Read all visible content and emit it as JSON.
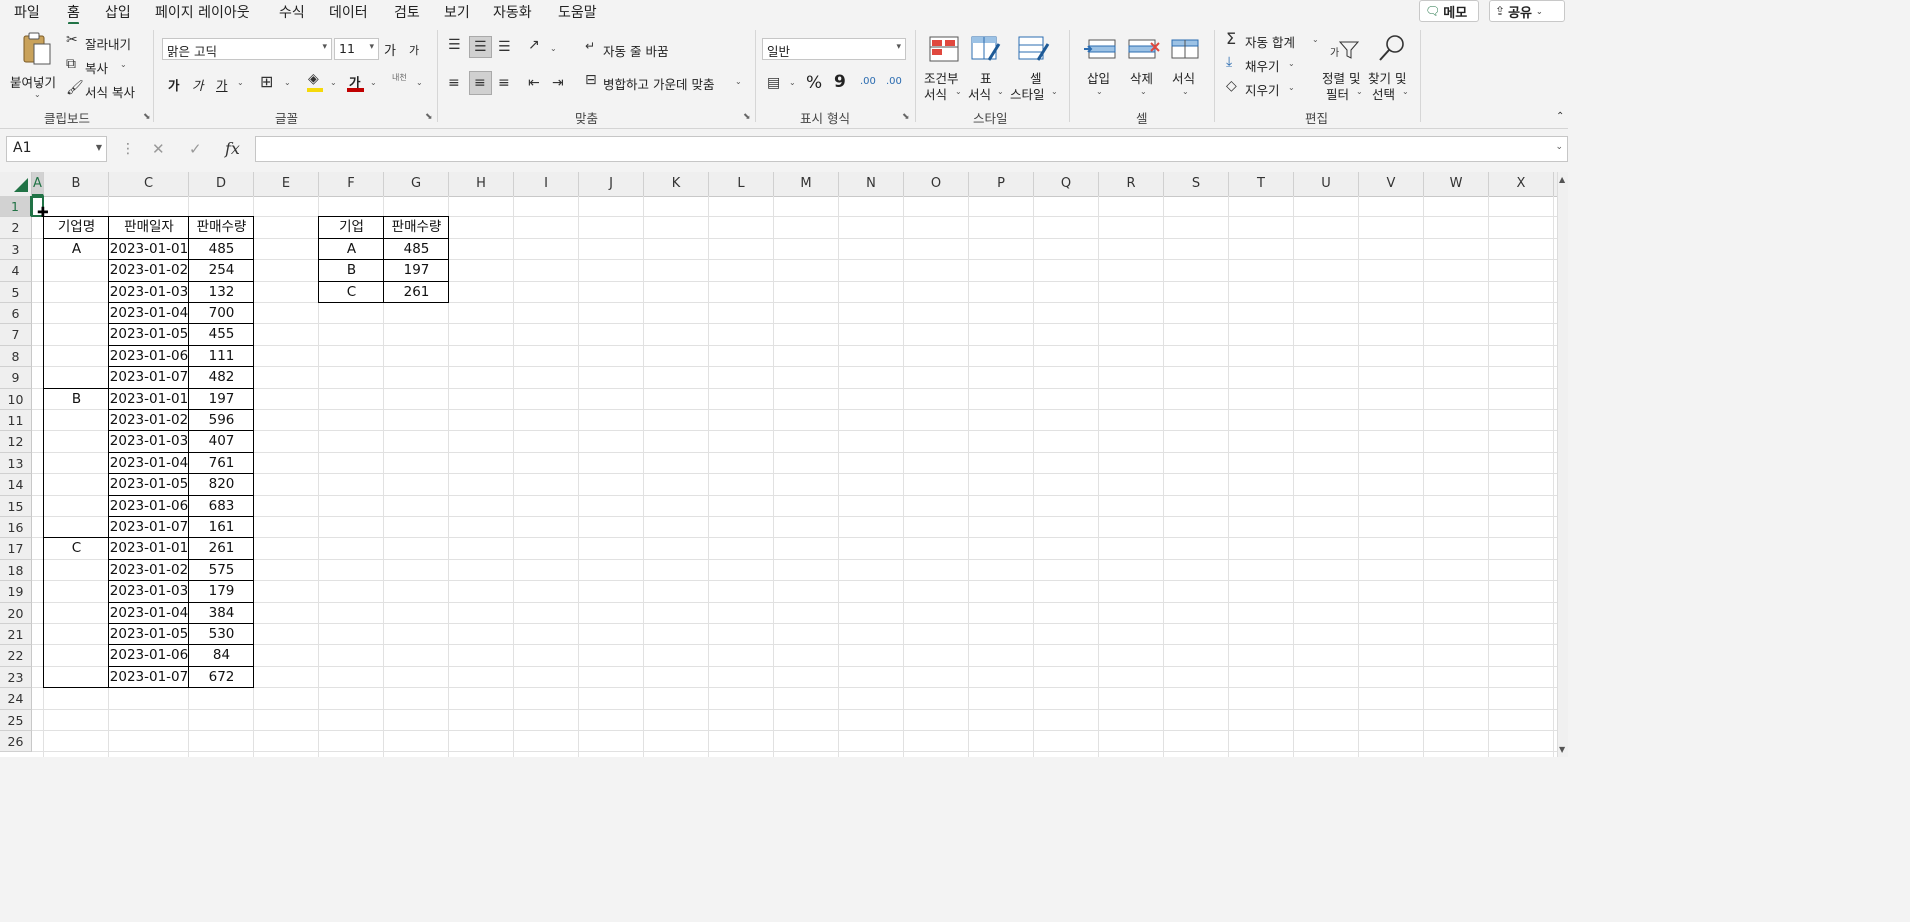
{
  "menu": {
    "tabs": [
      "파일",
      "홈",
      "삽입",
      "페이지 레이아웃",
      "수식",
      "데이터",
      "검토",
      "보기",
      "자동화",
      "도움말"
    ],
    "active": "홈",
    "memo_label": "메모",
    "share_label": "공유"
  },
  "ribbon": {
    "clipboard": {
      "paste": "붙여넣기",
      "cut": "잘라내기",
      "copy": "복사",
      "format_painter": "서식 복사",
      "label": "클립보드"
    },
    "font": {
      "name": "맑은 고딕",
      "size": "11",
      "grow": "가",
      "shrink": "가",
      "bold": "가",
      "italic": "가",
      "underline": "가",
      "color_glyph": "가",
      "phonetic": "내천",
      "label": "글꼴",
      "fill_color": "#f5d90a",
      "font_color": "#c00000"
    },
    "alignment": {
      "wrap": "자동 줄 바꿈",
      "merge": "병합하고 가운데 맞춤",
      "label": "맞춤"
    },
    "number": {
      "format": "일반",
      "percent": "%",
      "comma": "9",
      "inc": ".00",
      "dec": ".00",
      "label": "표시 형식"
    },
    "styles": {
      "conditional_1": "조건부",
      "conditional_2": "서식",
      "table_1": "표",
      "table_2": "서식",
      "cell_1": "셀",
      "cell_2": "스타일",
      "label": "스타일"
    },
    "cells": {
      "insert": "삽입",
      "delete": "삭제",
      "format": "서식",
      "label": "셀"
    },
    "editing": {
      "autosum": "자동 합계",
      "fill": "채우기",
      "clear": "지우기",
      "sort_1": "정렬 및",
      "sort_2": "필터",
      "find_1": "찾기 및",
      "find_2": "선택",
      "label": "편집"
    }
  },
  "formula_bar": {
    "name_box": "A1",
    "formula": ""
  },
  "columns": [
    "A",
    "B",
    "C",
    "D",
    "E",
    "F",
    "G",
    "H",
    "I",
    "J",
    "K",
    "L",
    "M",
    "N",
    "O",
    "P",
    "Q",
    "R",
    "S",
    "T",
    "U",
    "V",
    "W",
    "X"
  ],
  "rows": [
    "1",
    "2",
    "3",
    "4",
    "5",
    "6",
    "7",
    "8",
    "9",
    "10",
    "11",
    "12",
    "13",
    "14",
    "15",
    "16",
    "17",
    "18",
    "19",
    "20",
    "21",
    "22",
    "23",
    "24",
    "25",
    "26"
  ],
  "table1": {
    "headers": [
      "기업명",
      "판매일자",
      "판매수량"
    ],
    "rows": [
      [
        "A",
        "2023-01-01",
        "485"
      ],
      [
        "",
        "2023-01-02",
        "254"
      ],
      [
        "",
        "2023-01-03",
        "132"
      ],
      [
        "",
        "2023-01-04",
        "700"
      ],
      [
        "",
        "2023-01-05",
        "455"
      ],
      [
        "",
        "2023-01-06",
        "111"
      ],
      [
        "",
        "2023-01-07",
        "482"
      ],
      [
        "B",
        "2023-01-01",
        "197"
      ],
      [
        "",
        "2023-01-02",
        "596"
      ],
      [
        "",
        "2023-01-03",
        "407"
      ],
      [
        "",
        "2023-01-04",
        "761"
      ],
      [
        "",
        "2023-01-05",
        "820"
      ],
      [
        "",
        "2023-01-06",
        "683"
      ],
      [
        "",
        "2023-01-07",
        "161"
      ],
      [
        "C",
        "2023-01-01",
        "261"
      ],
      [
        "",
        "2023-01-02",
        "575"
      ],
      [
        "",
        "2023-01-03",
        "179"
      ],
      [
        "",
        "2023-01-04",
        "384"
      ],
      [
        "",
        "2023-01-05",
        "530"
      ],
      [
        "",
        "2023-01-06",
        "84"
      ],
      [
        "",
        "2023-01-07",
        "672"
      ]
    ]
  },
  "table2": {
    "headers": [
      "기업",
      "판매수량"
    ],
    "rows": [
      [
        "A",
        "485"
      ],
      [
        "B",
        "197"
      ],
      [
        "C",
        "261"
      ]
    ]
  },
  "colors": {
    "accent": "#217346"
  }
}
